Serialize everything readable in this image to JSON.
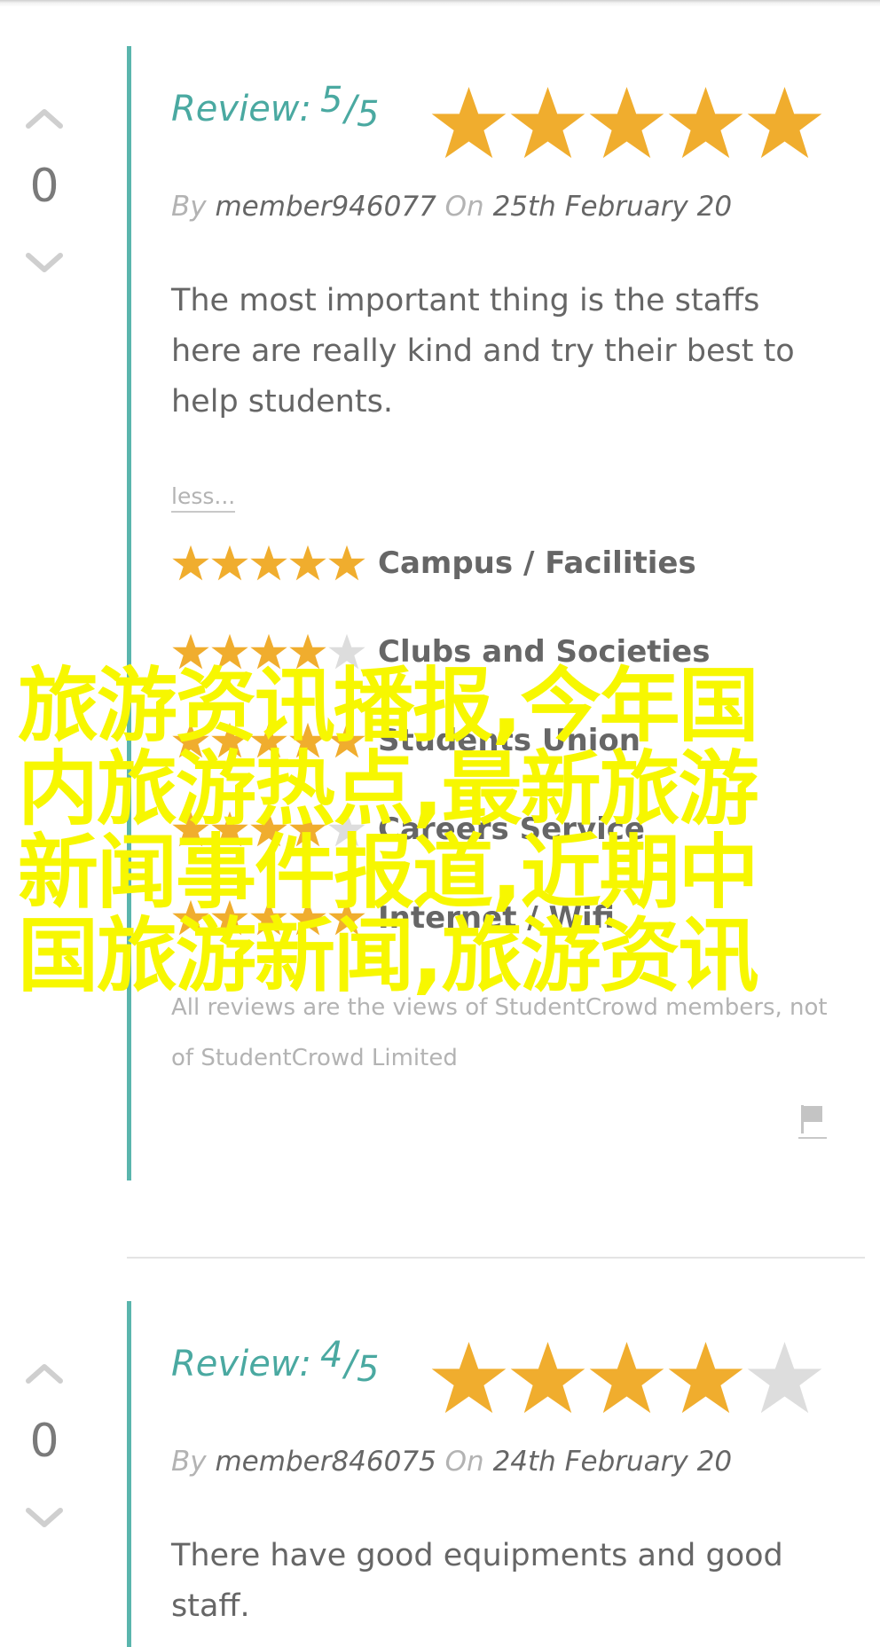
{
  "reviews": [
    {
      "votes": "0",
      "review_label": "Review:",
      "score": "5",
      "slash": "/",
      "out_of": "5",
      "rating": 5,
      "by_label": "By",
      "member": "member946077",
      "on_label": "On",
      "date": "25th February 20",
      "text": "The most important thing is the staffs here are really kind and try their best to help students.",
      "less_label": "less...",
      "sub_ratings": [
        {
          "category": "Campus / Facilities",
          "rating": 5
        },
        {
          "category": "Clubs and Societies",
          "rating": 4
        },
        {
          "category": "Students Union",
          "rating": 5
        },
        {
          "category": "Careers Service",
          "rating": 4
        },
        {
          "category": "Internet / Wifi",
          "rating": 5
        }
      ],
      "disclaimer": "All reviews are the views of StudentCrowd members, not of StudentCrowd Limited"
    },
    {
      "votes": "0",
      "review_label": "Review:",
      "score": "4",
      "slash": "/",
      "out_of": "5",
      "rating": 4,
      "by_label": "By",
      "member": "member846075",
      "on_label": "On",
      "date": "24th February 20",
      "text": "There have good equipments and good staff."
    }
  ],
  "overlay_text": "旅游资讯播报,今年国内旅游热点,最新旅游新闻事件报道,近期中国旅游新闻,旅游资讯",
  "colors": {
    "accent": "#5ab5ad",
    "title": "#4aa9a1",
    "star_filled": "#f0ad2e",
    "star_empty": "#dddddd",
    "overlay": "#f7f700"
  }
}
